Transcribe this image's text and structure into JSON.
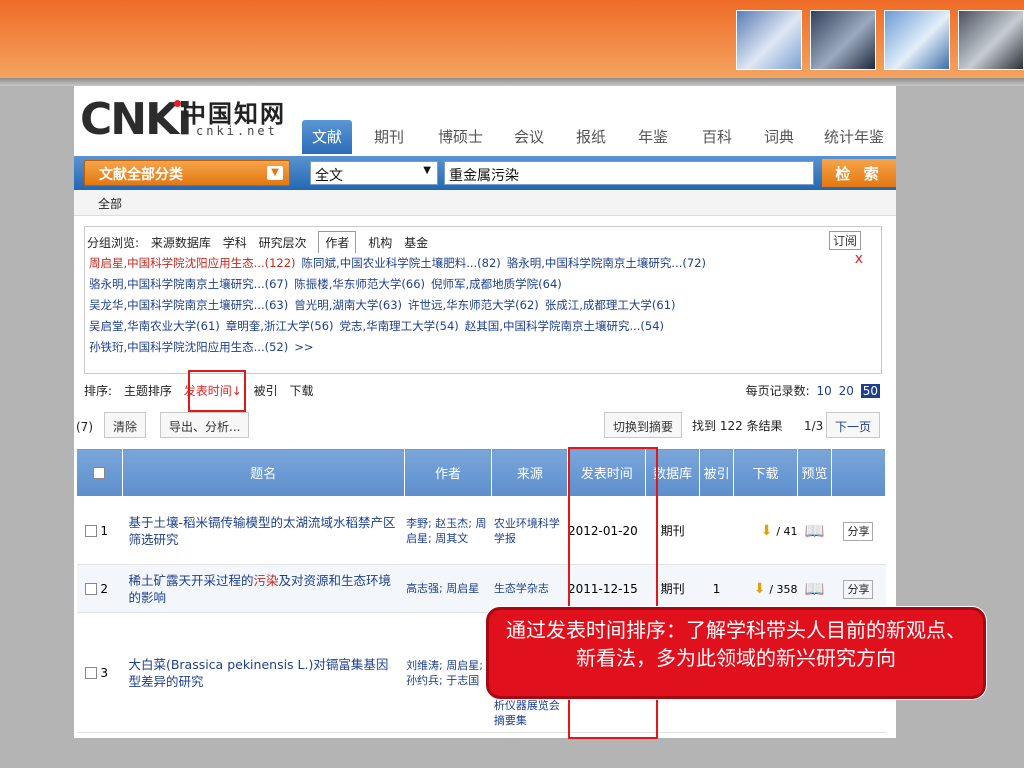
{
  "header_images": [
    "lab-photo",
    "researcher-photo",
    "world-map",
    "conference-photo"
  ],
  "logo": {
    "cnki": "CNKi",
    "cn": "中国知网",
    "net": "cnki.net"
  },
  "tabs": [
    "文献",
    "期刊",
    "博硕士",
    "会议",
    "报纸",
    "年鉴",
    "百科",
    "词典",
    "统计年鉴"
  ],
  "search": {
    "category": "文献全部分类",
    "field": "全文",
    "query": "重金属污染",
    "button": "检 索"
  },
  "breadcrumb": "全部",
  "group": {
    "label": "分组浏览:",
    "tabs": [
      "来源数据库",
      "学科",
      "研究层次",
      "作者",
      "机构",
      "基金"
    ],
    "active_tab": "作者",
    "subscribe": "订阅",
    "close": "x",
    "authors": [
      "周启星,中国科学院沈阳应用生态...(122)",
      "陈同斌,中国农业科学院土壤肥料...(82)",
      "骆永明,中国科学院南京土壤研究...(72)",
      "骆永明,中国科学院南京土壤研究...(67)",
      "陈振楼,华东师范大学(66)",
      "倪师军,成都地质学院(64)",
      "吴龙华,中国科学院南京土壤研究...(63)",
      "曾光明,湖南大学(63)",
      "许世远,华东师范大学(62)",
      "张成江,成都理工大学(61)",
      "吴启堂,华南农业大学(61)",
      "章明奎,浙江大学(56)",
      "党志,华南理工大学(54)",
      "赵其国,中国科学院南京土壤研究...(54)",
      "孙铁珩,中国科学院沈阳应用生态...(52)"
    ],
    "more": ">>"
  },
  "sort": {
    "label": "排序:",
    "options": [
      "主题排序",
      "发表时间↓",
      "被引",
      "下载"
    ],
    "active": "发表时间↓"
  },
  "per_page": {
    "label": "每页记录数:",
    "options": [
      "10",
      "20",
      "50"
    ],
    "selected": "50"
  },
  "toolbar": {
    "count": "(7)",
    "clear": "清除",
    "export": "导出、分析...",
    "switch": "切换到摘要",
    "found": "找到 122 条结果",
    "page": "1/3",
    "next": "下一页"
  },
  "table": {
    "headers": [
      "题名",
      "作者",
      "来源",
      "发表时间",
      "数据库",
      "被引",
      "下载",
      "预览"
    ],
    "rows": [
      {
        "num": "1",
        "title_before": "基于土壤-稻米镉传输模型的太湖流域水稻禁产区筛选研究",
        "title_hl": "",
        "title_after": "",
        "author": "李野; 赵玉杰; 周启星; 周其文",
        "source": "农业环境科学学报",
        "date": "2012-01-20",
        "db": "期刊",
        "cited": "",
        "downloads": "/ 41",
        "share": "分享"
      },
      {
        "num": "2",
        "title_before": "稀土矿露天开采过程的",
        "title_hl": "污染",
        "title_after": "及对资源和生态环境的影响",
        "author": "高志强; 周启星",
        "source": "生态学杂志",
        "date": "2011-12-15",
        "db": "期刊",
        "cited": "1",
        "downloads": "/ 358",
        "share": "分享"
      },
      {
        "num": "3",
        "title_before": "大白菜(Brassica pekinensis L.)对镉富集基因型差异的研究",
        "title_hl": "",
        "title_after": "",
        "author": "刘维涛; 周启星; 孙约兵; 于志国",
        "source": "析仪器展览会摘要集",
        "date": "",
        "db": "",
        "cited": "",
        "downloads": "",
        "share": ""
      }
    ]
  },
  "callout": "通过发表时间排序：了解学科带头人目前的新观点、新看法，多为此领域的新兴研究方向",
  "colors": {
    "orange": "#ee6b26",
    "blue_bar": "#2467b2",
    "link": "#1d3f8f",
    "highlight": "#e01818",
    "callout": "#e0101c"
  }
}
